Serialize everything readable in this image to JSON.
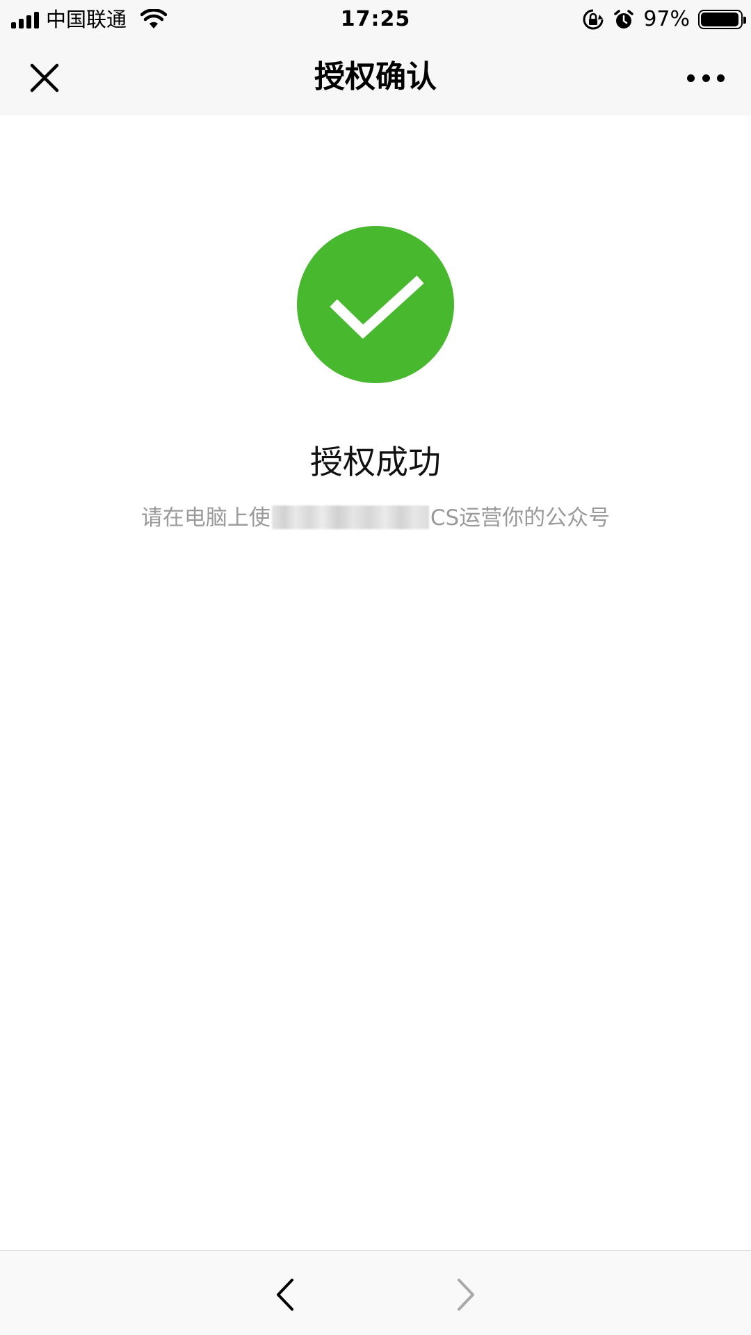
{
  "status_bar": {
    "carrier": "中国联通",
    "time": "17:25",
    "battery_percent": "97%",
    "battery_level": 0.97,
    "icons": [
      "signal-icon",
      "wifi-icon",
      "rotation-lock-icon",
      "alarm-icon",
      "battery-icon"
    ]
  },
  "nav": {
    "title": "授权确认",
    "close_icon": "close-icon",
    "more_icon": "more-icon"
  },
  "result": {
    "icon": "success-check-icon",
    "icon_color": "#48b92e",
    "title": "授权成功",
    "desc_prefix": "请在电脑上使",
    "desc_suffix": "CS运营你的公众号"
  },
  "toolbar": {
    "back_icon": "back-arrow-icon",
    "forward_icon": "forward-arrow-icon"
  }
}
